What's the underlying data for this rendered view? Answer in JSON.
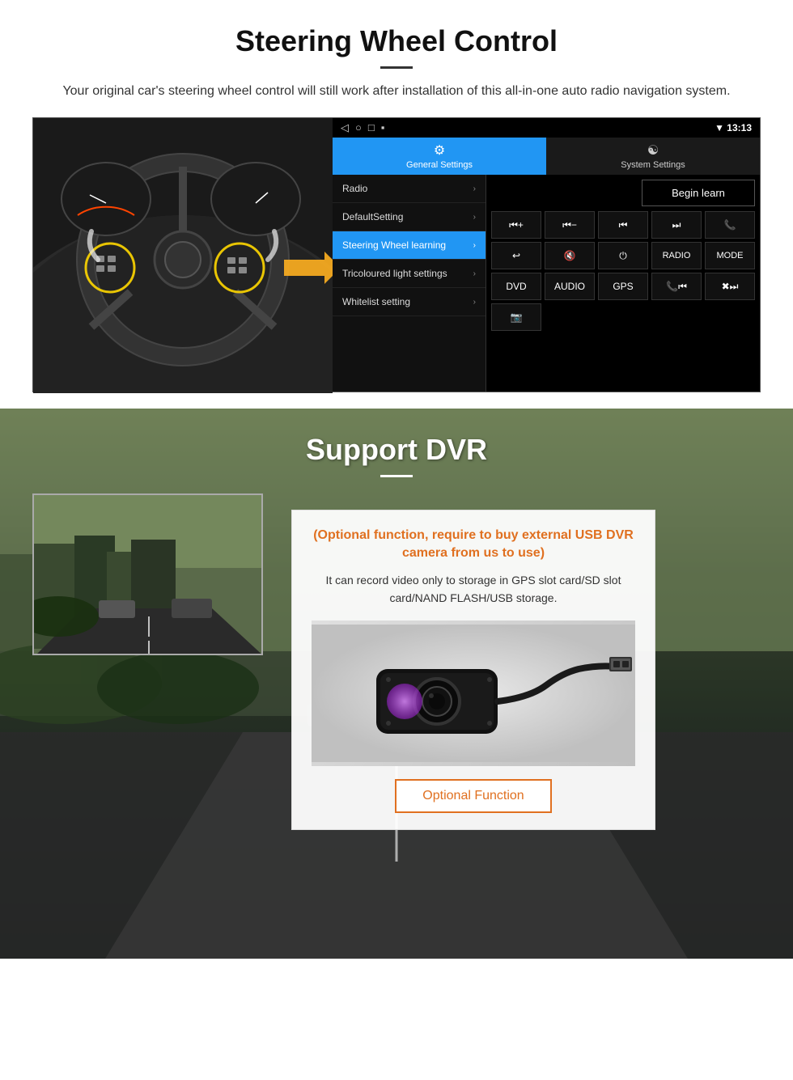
{
  "section1": {
    "title": "Steering Wheel Control",
    "subtitle": "Your original car's steering wheel control will still work after installation of this all-in-one auto radio navigation system.",
    "android_ui": {
      "status_bar": {
        "time": "13:13",
        "signal_icon": "▼",
        "wifi_icon": "▲"
      },
      "tabs": [
        {
          "label": "General Settings",
          "icon": "⚙",
          "active": true
        },
        {
          "label": "System Settings",
          "icon": "🔁",
          "active": false
        }
      ],
      "menu_items": [
        {
          "label": "Radio",
          "active": false
        },
        {
          "label": "DefaultSetting",
          "active": false
        },
        {
          "label": "Steering Wheel learning",
          "active": true
        },
        {
          "label": "Tricoloured light settings",
          "active": false
        },
        {
          "label": "Whitelist setting",
          "active": false
        }
      ],
      "begin_learn_label": "Begin learn",
      "control_buttons_row1": [
        "⏮+",
        "⏮-",
        "⏮|",
        "|⏭",
        "📞"
      ],
      "control_buttons_row2": [
        "↩",
        "🔇",
        "⏻",
        "RADIO",
        "MODE"
      ],
      "control_buttons_row3": [
        "DVD",
        "AUDIO",
        "GPS",
        "📞⏮|",
        "✖⏭|"
      ],
      "control_buttons_row4": [
        "📷"
      ]
    }
  },
  "section2": {
    "title": "Support DVR",
    "optional_title": "(Optional function, require to buy external USB DVR camera from us to use)",
    "description": "It can record video only to storage in GPS slot card/SD slot card/NAND FLASH/USB storage.",
    "optional_function_label": "Optional Function"
  }
}
